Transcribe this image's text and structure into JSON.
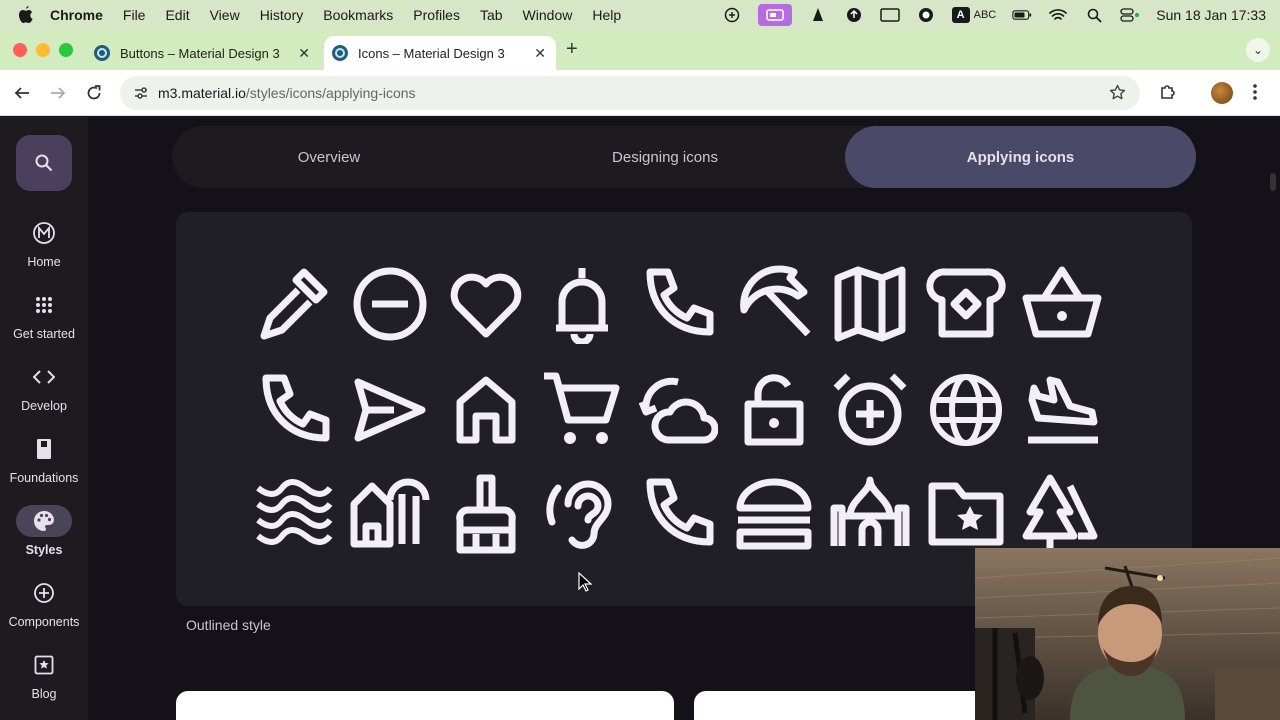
{
  "menubar": {
    "app": "Chrome",
    "items": [
      "File",
      "Edit",
      "View",
      "History",
      "Bookmarks",
      "Profiles",
      "Tab",
      "Window",
      "Help"
    ],
    "input_source": "ABC",
    "input_letter": "A",
    "datetime": "Sun 18 Jan  17:33"
  },
  "tabs": [
    {
      "title": "Buttons – Material Design 3",
      "active": false
    },
    {
      "title": "Icons – Material Design 3",
      "active": true
    }
  ],
  "address": {
    "host": "m3.material.io",
    "path": "/styles/icons/applying-icons"
  },
  "rail": {
    "items": [
      {
        "label": "Home",
        "icon": "m3-logo-icon"
      },
      {
        "label": "Get started",
        "icon": "apps-grid-icon"
      },
      {
        "label": "Develop",
        "icon": "code-icon"
      },
      {
        "label": "Foundations",
        "icon": "book-icon"
      },
      {
        "label": "Styles",
        "icon": "palette-icon",
        "selected": true
      },
      {
        "label": "Components",
        "icon": "add-circle-icon"
      },
      {
        "label": "Blog",
        "icon": "star-box-icon"
      }
    ]
  },
  "page_tabs": [
    {
      "label": "Overview"
    },
    {
      "label": "Designing icons"
    },
    {
      "label": "Applying icons",
      "active": true
    }
  ],
  "icon_grid": {
    "caption": "Outlined style",
    "rows": [
      [
        "colorize",
        "remove-circle",
        "favorite",
        "notifications",
        "call",
        "beach-umbrella",
        "map",
        "bakery",
        "shopping-basket"
      ],
      [
        "call",
        "send",
        "home",
        "shopping-cart",
        "cloud-sync",
        "lock-open",
        "alarm-add",
        "language",
        "flight-land"
      ],
      [
        "waves",
        "holiday-village",
        "cleaning",
        "hearing",
        "call",
        "lunch-dining",
        "mosque",
        "folder-special",
        "forest"
      ]
    ]
  },
  "colors": {
    "page_bg": "#141218",
    "rail_bg": "#1d1b20",
    "panel_bg": "#211f26",
    "active_tab": "#4a4a68",
    "tab_strip": "#d3ecbf",
    "menubar": "#d8e6c8"
  }
}
